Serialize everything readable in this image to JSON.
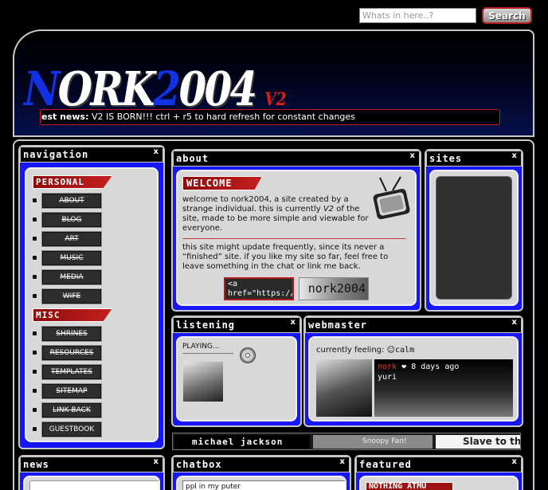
{
  "search": {
    "placeholder": "Whats in here..?",
    "button_label": "Search"
  },
  "header": {
    "logo_n": "N",
    "logo_ork": "ORK",
    "logo_2": "2",
    "logo_004": "004",
    "version": "V2",
    "ticker_label": "est news:",
    "ticker_text": "V2 IS BORN!!! ctrl + r5 to hard refresh for constant changes"
  },
  "navigation": {
    "title": "navigation",
    "close": "x",
    "groups": [
      {
        "label": "PERSONAL",
        "items": [
          "ABOUT",
          "BLOG",
          "ART",
          "MUSIC",
          "MEDIA",
          "WIFE"
        ]
      },
      {
        "label": "MISC",
        "items": [
          "SHRINES",
          "RESOURCES",
          "TEMPLATES",
          "SITEMAP",
          "LINK BACK",
          "GUESTBOOK"
        ]
      }
    ]
  },
  "about": {
    "title": "about",
    "close": "x",
    "welcome": "WELCOME",
    "para1_a": "welcome to nork2004, a site created by a strange individual. this is currently ",
    "para1_em": "V2",
    "para1_b": " of the site, made to be more simple and viewable for everyone.",
    "para2": "this site might update frequently, since its never a “finished” site. if you like my site so far, feel free to leave something in the chat or link me back.",
    "link_code": "<a href=\"https://",
    "button_text": "nork2004"
  },
  "sites": {
    "title": "sites",
    "close": "x"
  },
  "listening": {
    "title": "listening",
    "close": "x",
    "playing": "PLAYING..."
  },
  "webmaster": {
    "title": "webmaster",
    "close": "x",
    "feeling_label": "currently feeling:",
    "mood": "calm",
    "nick": "nork",
    "heart": "❤",
    "time_ago": "8 days ago",
    "partner": "yuri"
  },
  "stamps": [
    "michael jackson",
    "Snoopy Fan!",
    "Slave to th"
  ],
  "news": {
    "title": "news",
    "close": "x"
  },
  "chatbox": {
    "title": "chatbox",
    "close": "x",
    "message": "ppl in my puter"
  },
  "featured": {
    "title": "featured",
    "close": "x",
    "tag": "NOTHING ATMU"
  }
}
